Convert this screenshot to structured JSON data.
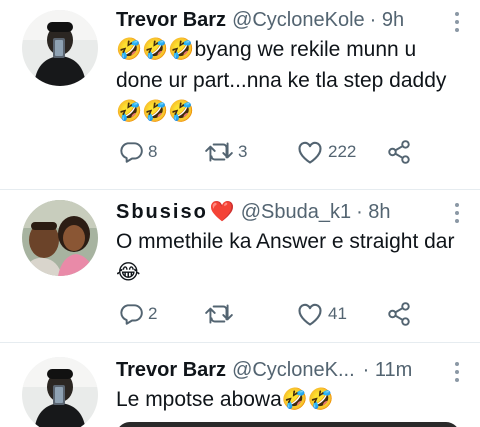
{
  "tweets": [
    {
      "name": "Trevor Barz",
      "handle": "@CycloneKole",
      "time": "· 9h",
      "text": "🤣🤣🤣byang we rekile munn u done ur part...nna ke tla step daddy 🤣🤣🤣",
      "replies": "8",
      "retweets": "3",
      "likes": "222"
    },
    {
      "name": "Sbusiso",
      "name_emoji": "❤️",
      "handle": "@Sbuda_k1",
      "time": "· 8h",
      "text": "O mmethile ka Answer e straight dar 😂",
      "replies": "2",
      "retweets": "",
      "likes": "41"
    },
    {
      "name": "Trevor Barz",
      "handle": "@CycloneK...",
      "time": "· 11m",
      "text": "Le mpotse abowa🤣🤣"
    }
  ],
  "icons": {
    "reply": "reply-icon",
    "retweet": "retweet-icon",
    "like": "like-icon",
    "share": "share-icon",
    "more": "more-icon"
  },
  "colors": {
    "text": "#0f1419",
    "muted": "#536471",
    "heart": "#e8243a"
  }
}
